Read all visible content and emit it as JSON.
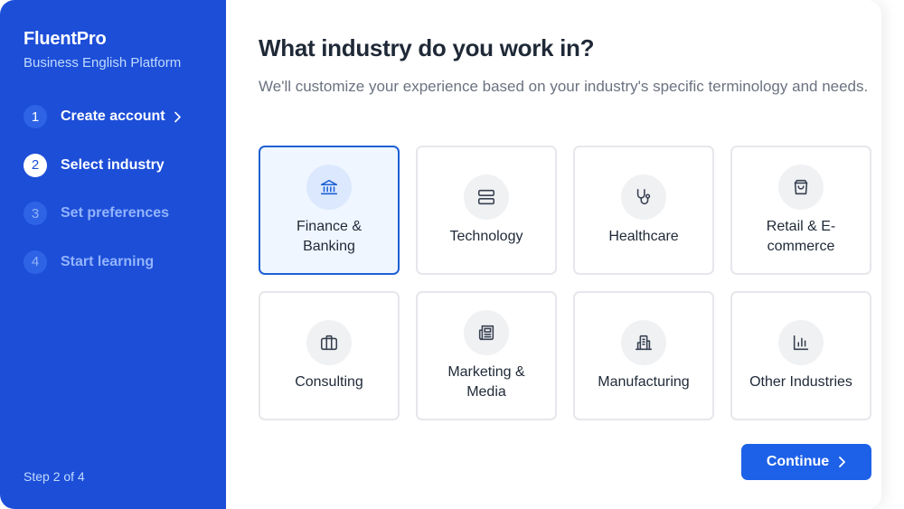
{
  "brand": {
    "title": "FluentPro",
    "subtitle": "Business English Platform"
  },
  "steps": [
    {
      "number": "1",
      "label": "Create account",
      "state": "done"
    },
    {
      "number": "2",
      "label": "Select industry",
      "state": "active"
    },
    {
      "number": "3",
      "label": "Set preferences",
      "state": "upcoming"
    },
    {
      "number": "4",
      "label": "Start learning",
      "state": "upcoming"
    }
  ],
  "step_count": "Step 2 of 4",
  "main": {
    "title": "What industry do you work in?",
    "description": "We'll customize your experience based on your industry's specific terminology and needs."
  },
  "industries": [
    {
      "label": "Finance & Banking",
      "icon": "bank-icon",
      "selected": true
    },
    {
      "label": "Technology",
      "icon": "server-icon",
      "selected": false
    },
    {
      "label": "Healthcare",
      "icon": "stethoscope-icon",
      "selected": false
    },
    {
      "label": "Retail & E-commerce",
      "icon": "shopping-bag-icon",
      "selected": false
    },
    {
      "label": "Consulting",
      "icon": "briefcase-icon",
      "selected": false
    },
    {
      "label": "Marketing & Media",
      "icon": "newspaper-icon",
      "selected": false
    },
    {
      "label": "Manufacturing",
      "icon": "factory-building-icon",
      "selected": false
    },
    {
      "label": "Other Industries",
      "icon": "bar-chart-icon",
      "selected": false
    }
  ],
  "continue_label": "Continue",
  "colors": {
    "sidebar": "#1d4ed8",
    "accent": "#1d61e8",
    "selected_border": "#1d61d4",
    "selected_bg": "#eff6ff"
  }
}
